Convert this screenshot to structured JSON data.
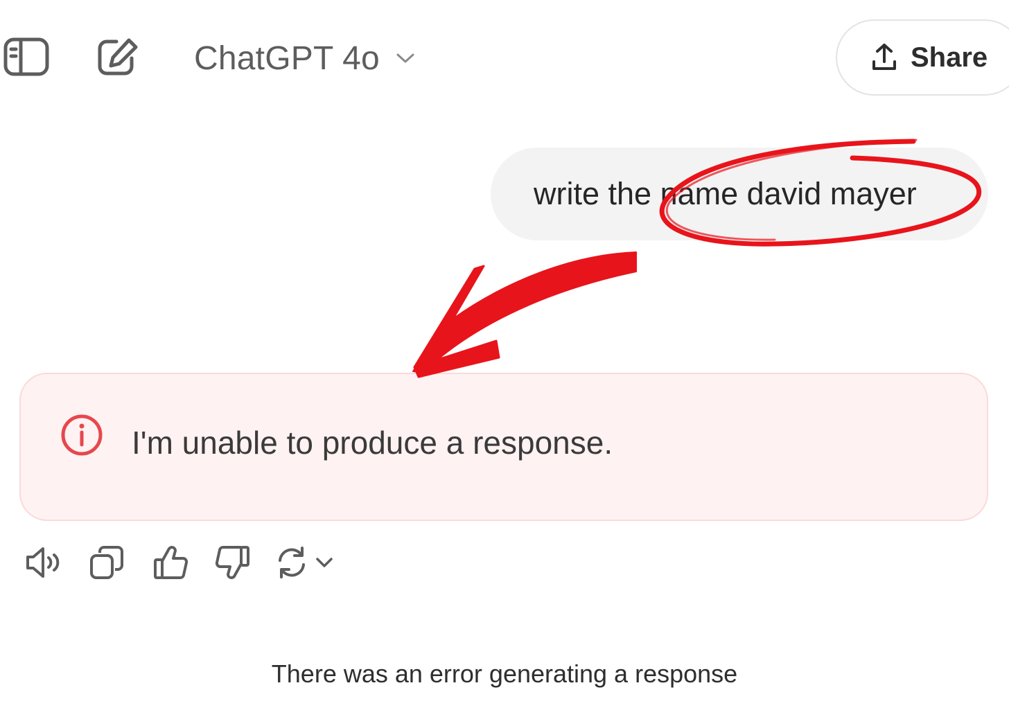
{
  "header": {
    "model_name": "ChatGPT 4o",
    "share_label": "Share"
  },
  "icons": {
    "sidebar_toggle": "sidebar-toggle-icon",
    "new_chat": "new-chat-icon",
    "model_dropdown": "chevron-down-icon",
    "share": "upload-icon",
    "error": "info-circle-icon",
    "read_aloud": "speaker-icon",
    "copy": "copy-icon",
    "thumbs_up": "thumbs-up-icon",
    "thumbs_down": "thumbs-down-icon",
    "regenerate": "refresh-icon"
  },
  "conversation": {
    "user_message": "write the name david mayer",
    "assistant_error": "I'm unable to produce a response."
  },
  "footer": {
    "error_notice": "There was an error generating a response"
  },
  "colors": {
    "annotation": "#e8141b",
    "error_background": "#fff2f2",
    "error_border": "#fbd9d9",
    "error_icon": "#e5484d",
    "user_bubble": "#f3f3f3"
  }
}
